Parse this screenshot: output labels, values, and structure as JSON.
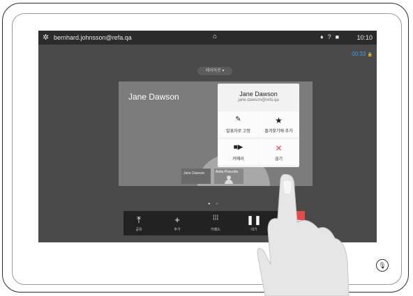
{
  "status_bar": {
    "user": "bernhard.johnsson@refa.qa",
    "time": "10:10"
  },
  "call": {
    "timer": "00:33",
    "layout_button": "레이아웃 ▾",
    "participant_name": "Jane Dawson"
  },
  "popup": {
    "name": "Jane Dawson",
    "email": "jane.dawson@refa.qa",
    "actions": [
      {
        "icon": "pin-icon",
        "glyph": "📌",
        "label": "발표자로 고정"
      },
      {
        "icon": "star-icon",
        "glyph": "★",
        "label": "즐겨찾기에 추가"
      },
      {
        "icon": "camera-icon",
        "glyph": "■◀",
        "label": "카메라"
      },
      {
        "icon": "close-icon",
        "glyph": "✕",
        "label": "끊기"
      }
    ]
  },
  "thumbnails": [
    "Jane Dawson",
    "Anita Poscotto"
  ],
  "toolbar": {
    "buttons": [
      {
        "icon": "share-icon",
        "glyph": "⇧",
        "label": "공유"
      },
      {
        "icon": "add-icon",
        "glyph": "+",
        "label": "추가"
      },
      {
        "icon": "keypad-icon",
        "glyph": "⁙⁙",
        "label": "키패드"
      },
      {
        "icon": "hold-icon",
        "glyph": "❚❚",
        "label": "대기"
      }
    ]
  },
  "colors": {
    "accent_blue": "#3fa0e0",
    "end_call_red": "#e64b4b",
    "close_red": "#e64b4b"
  }
}
